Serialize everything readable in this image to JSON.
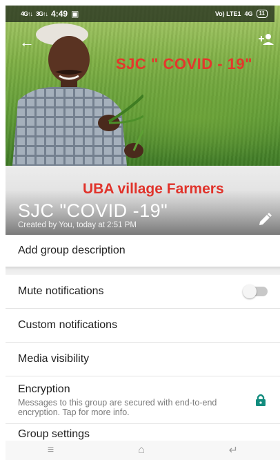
{
  "status_bar": {
    "signal1": "4G↑↓",
    "signal2": "3G↑↓",
    "time": "4:49",
    "volte": "Vo) LTE1",
    "network": "4G",
    "battery": "11"
  },
  "header": {
    "photo_caption": "SJC \" COVID - 19\"",
    "photo_subtitle": "UBA village Farmers",
    "group_name": "SJC \"COVID -19\"",
    "created": "Created by You, today at 2:51 PM"
  },
  "settings": {
    "description": "Add group description",
    "mute": "Mute notifications",
    "mute_on": false,
    "custom": "Custom notifications",
    "media": "Media visibility",
    "encryption_title": "Encryption",
    "encryption_desc": "Messages to this group are secured with end-to-end encryption. Tap for more info.",
    "group_settings": "Group settings"
  },
  "nav": {
    "menu_icon": "≡",
    "home_icon": "⌂",
    "back_icon": "↵"
  },
  "colors": {
    "accent_green": "#128C7E",
    "caption_red": "#e4372c"
  }
}
